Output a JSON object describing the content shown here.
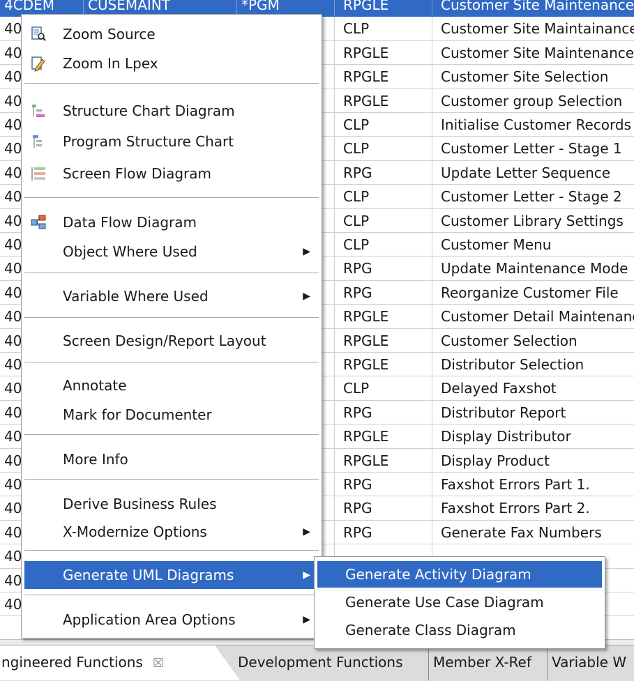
{
  "table": {
    "rows": [
      {
        "c1": "4CDEM",
        "c2": "CUSEMAINT",
        "c3": "*PGM",
        "type": "RPGLE",
        "desc": "Customer Site Maintenance",
        "selected": true
      },
      {
        "c1": "40",
        "type": "CLP",
        "desc": "Customer Site Maintainance"
      },
      {
        "c1": "40",
        "type": "RPGLE",
        "desc": "Customer Site Maintenance"
      },
      {
        "c1": "40",
        "type": "RPGLE",
        "desc": "Customer Site Selection"
      },
      {
        "c1": "40",
        "type": "RPGLE",
        "desc": "Customer group Selection"
      },
      {
        "c1": "40",
        "type": "CLP",
        "desc": "Initialise Customer Records"
      },
      {
        "c1": "40",
        "type": "CLP",
        "desc": "Customer Letter - Stage 1"
      },
      {
        "c1": "40",
        "type": "RPG",
        "desc": "Update Letter Sequence"
      },
      {
        "c1": "40",
        "type": "CLP",
        "desc": "Customer Letter - Stage 2"
      },
      {
        "c1": "40",
        "type": "CLP",
        "desc": "Customer Library Settings"
      },
      {
        "c1": "40",
        "type": "CLP",
        "desc": "Customer Menu"
      },
      {
        "c1": "40",
        "type": "RPG",
        "desc": "Update Maintenance Mode"
      },
      {
        "c1": "40",
        "type": "RPG",
        "desc": "Reorganize Customer File"
      },
      {
        "c1": "40",
        "type": "RPGLE",
        "desc": "Customer Detail Maintenance"
      },
      {
        "c1": "40",
        "type": "RPGLE",
        "desc": "Customer Selection"
      },
      {
        "c1": "40",
        "type": "RPGLE",
        "desc": "Distributor Selection"
      },
      {
        "c1": "40",
        "type": "CLP",
        "desc": "Delayed Faxshot"
      },
      {
        "c1": "40",
        "type": "RPG",
        "desc": "Distributor Report"
      },
      {
        "c1": "40",
        "type": "RPGLE",
        "desc": "Display Distributor"
      },
      {
        "c1": "40",
        "type": "RPGLE",
        "desc": "Display Product"
      },
      {
        "c1": "40",
        "type": "RPG",
        "desc": "Faxshot Errors Part 1."
      },
      {
        "c1": "40",
        "type": "RPG",
        "desc": "Faxshot Errors Part 2."
      },
      {
        "c1": "40",
        "type": "RPG",
        "desc": "Generate Fax Numbers"
      },
      {
        "c1": "40",
        "type": "",
        "desc": ""
      },
      {
        "c1": "40",
        "type": "",
        "desc": ""
      },
      {
        "c1": "40",
        "type": "",
        "desc": ""
      }
    ]
  },
  "tabs": {
    "active_label": "ngineered Functions",
    "close_glyph": "☒",
    "t2": "Development Functions",
    "t3": "Member X-Ref",
    "t4": "Variable W"
  },
  "menu": {
    "zoom_source": "Zoom Source",
    "zoom_lpex": "Zoom In Lpex",
    "structure_chart": "Structure Chart Diagram",
    "program_structure": "Program Structure Chart",
    "screen_flow": "Screen Flow Diagram",
    "data_flow": "Data Flow Diagram",
    "object_where_used": "Object Where Used",
    "variable_where_used": "Variable Where Used",
    "screen_design": "Screen Design/Report Layout",
    "annotate": "Annotate",
    "mark_documenter": "Mark for Documenter",
    "more_info": "More Info",
    "derive_rules": "Derive Business Rules",
    "xmodernize": "X-Modernize Options",
    "generate_uml": "Generate UML Diagrams",
    "app_area": "Application Area Options",
    "arrow": "▶"
  },
  "submenu": {
    "activity": "Generate Activity Diagram",
    "use_case": "Generate Use Case Diagram",
    "class_diagram": "Generate Class Diagram"
  },
  "colors": {
    "selection": "#316ac5"
  }
}
